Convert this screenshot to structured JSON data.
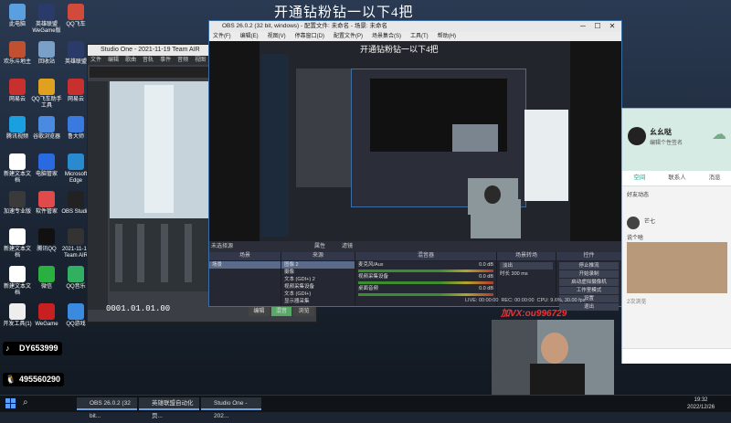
{
  "banner": "开通钻粉钻一以下4把",
  "desktop_icons": [
    {
      "label": "此电脑",
      "color": "#5aa0e0"
    },
    {
      "label": "英雄联盟 WeGame版",
      "color": "#2a3b6a"
    },
    {
      "label": "QQ飞车",
      "color": "#d24a3a"
    },
    {
      "label": "欢乐斗地主",
      "color": "#c05030"
    },
    {
      "label": "回收站",
      "color": "#7aa0c8"
    },
    {
      "label": "英雄联盟",
      "color": "#2a3b6a"
    },
    {
      "label": "网易云",
      "color": "#c82f2f"
    },
    {
      "label": "QQ飞车助手 工具",
      "color": "#e0a020"
    },
    {
      "label": "网易云",
      "color": "#c82f2f"
    },
    {
      "label": "腾讯视频",
      "color": "#1aa0e0"
    },
    {
      "label": "谷歌浏览器",
      "color": "#4a8ae0"
    },
    {
      "label": "鲁大师",
      "color": "#3a7ae0"
    },
    {
      "label": "新建文本文档",
      "color": "#ffffff"
    },
    {
      "label": "电脑管家",
      "color": "#2a6ae0"
    },
    {
      "label": "Microsoft Edge",
      "color": "#2a8ad0"
    },
    {
      "label": "加速专业版",
      "color": "#3a3a3a"
    },
    {
      "label": "软件管家",
      "color": "#e04a4a"
    },
    {
      "label": "OBS Studio",
      "color": "#222222"
    },
    {
      "label": "新建文本文档",
      "color": "#ffffff"
    },
    {
      "label": "腾讯QQ",
      "color": "#111111"
    },
    {
      "label": "2021-11-19 Team AIR",
      "color": "#333333"
    },
    {
      "label": "新建文本文档",
      "color": "#ffffff"
    },
    {
      "label": "微信",
      "color": "#2ab040"
    },
    {
      "label": "QQ音乐",
      "color": "#30b060"
    },
    {
      "label": "开发工具(1)",
      "color": "#eeeeee"
    },
    {
      "label": "WeGame",
      "color": "#c82020"
    },
    {
      "label": "QQ游戏",
      "color": "#3a8ae0"
    },
    {
      "label": "360安全浏览器",
      "color": "#3ab050"
    }
  ],
  "social": {
    "douyin": "DY653999",
    "qq": "495560290"
  },
  "studio": {
    "title": "Studio One - 2021-11-19 Team AIR",
    "menu": [
      "文件",
      "编辑",
      "歌曲",
      "音轨",
      "事件",
      "音频",
      "视图",
      "选项",
      "帮助"
    ],
    "time": "0001.01.01.00",
    "bottom_tabs": [
      "编辑",
      "混音",
      "浏览"
    ]
  },
  "obs": {
    "title": "OBS 26.0.2 (32 bit, windows) - 配置文件: 未命名 - 场景: 未命名",
    "menu": [
      "文件(F)",
      "编辑(E)",
      "视图(V)",
      "停靠窗口(D)",
      "配置文件(P)",
      "场景集合(S)",
      "工具(T)",
      "帮助(H)"
    ],
    "no_source": "未选择源",
    "properties": "属性",
    "filters": "滤镜",
    "panels": {
      "scenes": "场景",
      "sources": "来源",
      "mixer": "混音器",
      "transitions": "场景转场",
      "controls": "控件"
    },
    "scenes": [
      "场景"
    ],
    "sources": [
      "图像 2",
      "摄像",
      "文本 (GDI+) 2",
      "视频采集设备",
      "文本 (GDI+)",
      "显示器采集"
    ],
    "mixer": [
      {
        "name": "麦克风/Aux",
        "db": "0.0 dB"
      },
      {
        "name": "视频采集设备",
        "db": "0.0 dB"
      },
      {
        "name": "桌面音频",
        "db": "0.0 dB"
      }
    ],
    "transition": {
      "type": "淡出",
      "duration_label": "时长",
      "duration": "300 ms"
    },
    "controls": [
      "停止推流",
      "开始录制",
      "启动虚拟摄像机",
      "工作室模式",
      "设置",
      "退出"
    ],
    "status": {
      "live": "LIVE: 00:00:00",
      "rec": "REC: 00:00:00",
      "cpu": "CPU: 9.6%, 30.00 fps"
    }
  },
  "preview_banner": "开通钻粉钻一以下4把",
  "overlay_vx": "加VX:ou996729",
  "phone": {
    "name": "幺幺哒",
    "status": "编辑个性签名",
    "tabs": [
      "空间",
      "联系人",
      "消息"
    ],
    "section": "好友动态",
    "poster": "芒七",
    "post_text": "说个啥",
    "comments": "2次浏览"
  },
  "taskbar": {
    "items": [
      "OBS 26.0.2 (32 bit...",
      "英雄联盟自动化页...",
      "Studio One - 202..."
    ],
    "time": "19:32",
    "date": "2022/12/26"
  }
}
